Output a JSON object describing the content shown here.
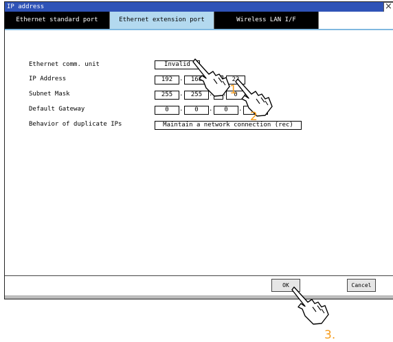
{
  "window": {
    "title": "IP address",
    "close_symbol": "×"
  },
  "tabs": [
    {
      "label": "Ethernet standard port",
      "active": false
    },
    {
      "label": "Ethernet extension port",
      "active": true
    },
    {
      "label": "Wireless LAN I/F",
      "active": false
    }
  ],
  "form": {
    "comm_unit": {
      "label": "Ethernet comm. unit",
      "value": "Invalid"
    },
    "ip_address": {
      "label": "IP Address",
      "octets": [
        "192",
        "168",
        "",
        "22"
      ]
    },
    "subnet_mask": {
      "label": "Subnet Mask",
      "octets": [
        "255",
        "255",
        "",
        "0"
      ]
    },
    "default_gateway": {
      "label": "Default Gateway",
      "octets": [
        "0",
        "0",
        "0",
        "0"
      ]
    },
    "duplicate_ips": {
      "label": "Behavior of duplicate IPs",
      "value": "Maintain a network connection (rec)"
    }
  },
  "footer": {
    "ok_label": "OK",
    "cancel_label": "Cancel"
  },
  "annotations": {
    "step1": "1",
    "step2": "2",
    "step3": "3."
  },
  "colors": {
    "titlebar": "#2f53b7",
    "active_tab": "#b3d9ef",
    "step_number": "#f59b1b"
  }
}
